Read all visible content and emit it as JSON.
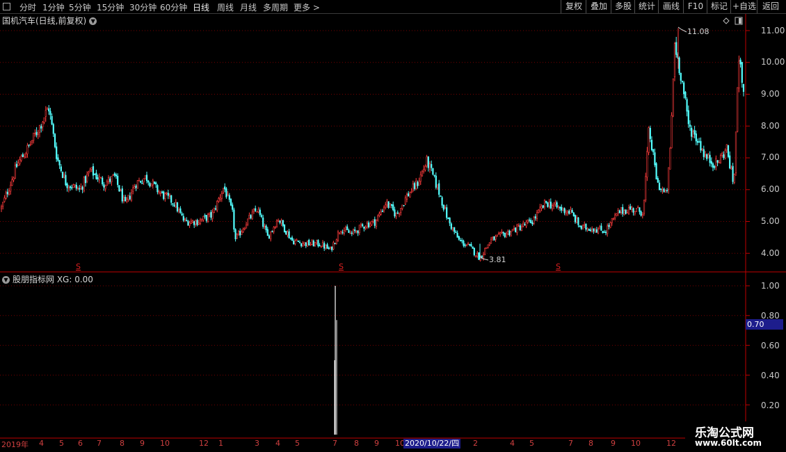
{
  "toolbar": {
    "periods": [
      "分时",
      "1分钟",
      "5分钟",
      "15分钟",
      "30分钟",
      "60分钟",
      "日线",
      "周线",
      "月线",
      "多周期",
      "更多 >"
    ],
    "active_period": "日线",
    "right_buttons": [
      "复权",
      "叠加",
      "多股",
      "统计",
      "画线",
      "F10",
      "标记",
      "+自选",
      "返回"
    ]
  },
  "main_panel": {
    "title": "国机汽车(日线,前复权)",
    "high_label": "11.08",
    "low_label": "3.81",
    "s_marker": "S",
    "y_ticks": [
      "11.00",
      "10.00",
      "9.00",
      "8.00",
      "7.00",
      "6.00",
      "5.00",
      "4.00"
    ]
  },
  "indicator_panel": {
    "title": "股朋指标网 XG: 0.00",
    "y_ticks": [
      "1.00",
      "0.80",
      "0.60",
      "0.40",
      "0.20"
    ],
    "price_marker": "0.70"
  },
  "date_axis": {
    "labels": [
      "2019年",
      "4",
      "5",
      "6",
      "7",
      "8",
      "9",
      "10",
      "12",
      "1",
      "3",
      "4",
      "5",
      "7",
      "8",
      "9",
      "10",
      "2",
      "4",
      "5",
      "7",
      "8",
      "9",
      "10",
      "12"
    ],
    "cursor_date": "2020/10/22/四"
  },
  "watermark": {
    "line1": "乐淘公式网",
    "line2": "www.60lt.com"
  },
  "colors": {
    "up": "#ff3c3c",
    "down": "#54ffff",
    "axis": "#c00000",
    "grid": "#7a0000",
    "highlight": "#1d1d8c"
  },
  "chart_data": {
    "type": "candlestick",
    "title": "国机汽车(日线,前复权)",
    "ylim": [
      3.6,
      11.2
    ],
    "x_start": "2019",
    "high": 11.08,
    "low": 3.81,
    "price_path": [
      [
        0,
        5.3
      ],
      [
        10,
        5.9
      ],
      [
        25,
        6.8
      ],
      [
        40,
        7.3
      ],
      [
        55,
        7.9
      ],
      [
        70,
        8.6
      ],
      [
        82,
        7.0
      ],
      [
        95,
        6.2
      ],
      [
        115,
        6.0
      ],
      [
        130,
        6.6
      ],
      [
        150,
        6.2
      ],
      [
        165,
        6.4
      ],
      [
        180,
        5.5
      ],
      [
        195,
        6.2
      ],
      [
        210,
        6.4
      ],
      [
        230,
        5.9
      ],
      [
        250,
        5.6
      ],
      [
        265,
        5.0
      ],
      [
        285,
        5.0
      ],
      [
        305,
        5.2
      ],
      [
        322,
        6.1
      ],
      [
        335,
        5.2
      ],
      [
        338,
        4.4
      ],
      [
        355,
        5.0
      ],
      [
        370,
        5.4
      ],
      [
        385,
        4.5
      ],
      [
        400,
        5.1
      ],
      [
        420,
        4.4
      ],
      [
        440,
        4.3
      ],
      [
        460,
        4.3
      ],
      [
        475,
        4.1
      ],
      [
        490,
        4.8
      ],
      [
        505,
        4.6
      ],
      [
        525,
        4.9
      ],
      [
        540,
        5.0
      ],
      [
        555,
        5.6
      ],
      [
        570,
        5.2
      ],
      [
        585,
        5.8
      ],
      [
        600,
        6.2
      ],
      [
        614,
        6.9
      ],
      [
        630,
        6.0
      ],
      [
        645,
        5.0
      ],
      [
        660,
        4.4
      ],
      [
        675,
        4.2
      ],
      [
        690,
        3.85
      ],
      [
        705,
        4.4
      ],
      [
        725,
        4.6
      ],
      [
        745,
        4.8
      ],
      [
        765,
        5.0
      ],
      [
        785,
        5.6
      ],
      [
        805,
        5.4
      ],
      [
        820,
        5.3
      ],
      [
        835,
        4.8
      ],
      [
        850,
        4.8
      ],
      [
        870,
        4.7
      ],
      [
        890,
        5.3
      ],
      [
        905,
        5.4
      ],
      [
        925,
        5.3
      ],
      [
        933,
        7.9
      ],
      [
        945,
        6.2
      ],
      [
        958,
        5.8
      ],
      [
        963,
        7.0
      ],
      [
        970,
        10.6
      ],
      [
        980,
        9.5
      ],
      [
        990,
        8.0
      ],
      [
        1005,
        7.5
      ],
      [
        1015,
        7.0
      ],
      [
        1030,
        6.8
      ],
      [
        1045,
        7.3
      ],
      [
        1055,
        6.1
      ],
      [
        1063,
        10.6
      ],
      [
        1072,
        8.0
      ]
    ],
    "indicator": {
      "type": "bar",
      "name": "XG",
      "ylim": [
        0,
        1.1
      ],
      "spike_at_x": 482,
      "spike_value": 1.0,
      "other_values": 0
    }
  }
}
